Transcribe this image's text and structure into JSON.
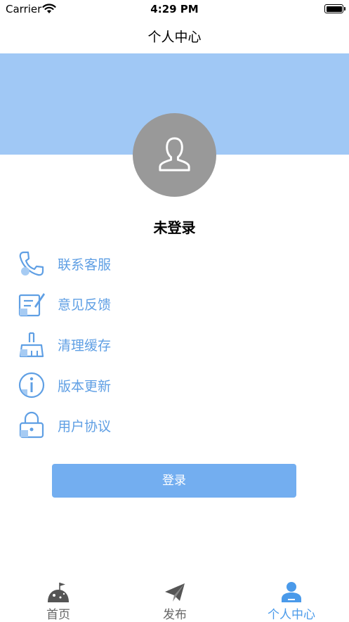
{
  "status_bar": {
    "carrier": "Carrier",
    "time": "4:29 PM"
  },
  "nav": {
    "title": "个人中心"
  },
  "profile": {
    "login_status": "未登录",
    "avatar_icon": "user-icon"
  },
  "menu": {
    "items": [
      {
        "label": "联系客服",
        "icon": "phone-icon"
      },
      {
        "label": "意见反馈",
        "icon": "feedback-icon"
      },
      {
        "label": "清理缓存",
        "icon": "brush-icon"
      },
      {
        "label": "版本更新",
        "icon": "info-icon"
      },
      {
        "label": "用户协议",
        "icon": "lock-icon"
      }
    ]
  },
  "login_button": {
    "label": "登录"
  },
  "tab_bar": {
    "tabs": [
      {
        "label": "首页",
        "icon": "home-icon",
        "active": false
      },
      {
        "label": "发布",
        "icon": "send-icon",
        "active": false
      },
      {
        "label": "个人中心",
        "icon": "person-icon",
        "active": true
      }
    ]
  },
  "colors": {
    "accent": "#5f9fe4",
    "banner": "#a0c8f5",
    "button": "#73aef0",
    "avatar_bg": "#999999"
  }
}
